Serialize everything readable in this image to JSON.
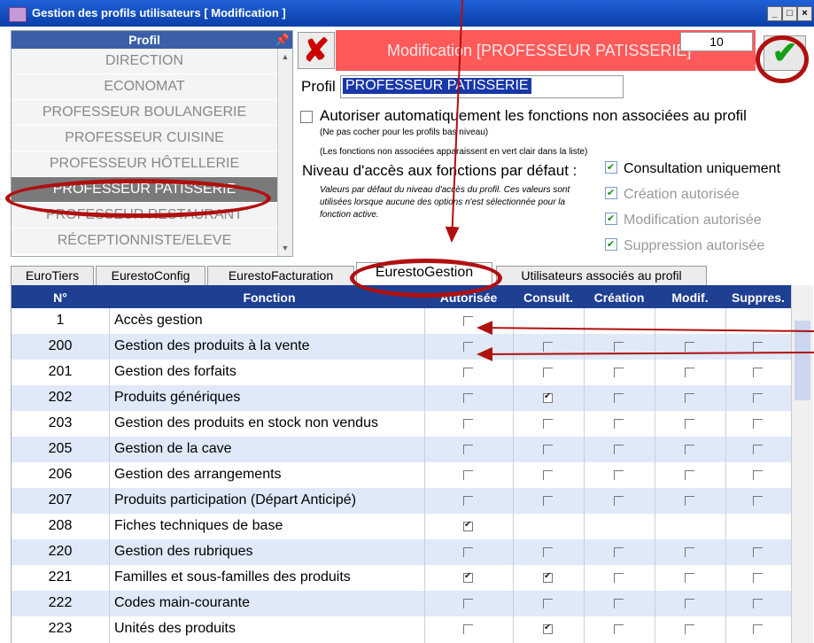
{
  "window": {
    "title": "Gestion des profils utilisateurs  [ Modification ]"
  },
  "profile_list": {
    "header": "Profil",
    "items": [
      "DIRECTION",
      "ECONOMAT",
      "PROFESSEUR BOULANGERIE",
      "PROFESSEUR CUISINE",
      "PROFESSEUR HÔTELLERIE",
      "PROFESSEUR PATISSERIE",
      "PROFESSEUR RESTAURANT",
      "RÉCEPTIONNISTE/ELEVE"
    ],
    "selected": "PROFESSEUR PATISSERIE"
  },
  "header": {
    "title": "Modification [PROFESSEUR PATISSERIE]",
    "counter": "10"
  },
  "form": {
    "profil_label": "Profil",
    "profil_value": "PROFESSEUR PATISSERIE",
    "auto_label": "Autoriser automatiquement les fonctions non associées au profil",
    "note1": "(Ne pas cocher pour les profils bas niveau)",
    "note2": "(Les fonctions non associées apparaissent en vert clair dans la liste)",
    "niveau_label": "Niveau d'accès aux fonctions par défaut :",
    "defaults_note": "Valeurs par défaut du niveau d'accès du profil. Ces valeurs sont utilisées lorsque aucune des options n'est sélectionnée pour la fonction active.",
    "options": [
      {
        "label": "Consultation uniquement",
        "checked": true,
        "enabled": true
      },
      {
        "label": "Création autorisée",
        "checked": true,
        "enabled": false
      },
      {
        "label": "Modification autorisée",
        "checked": true,
        "enabled": false
      },
      {
        "label": "Suppression autorisée",
        "checked": true,
        "enabled": false
      }
    ]
  },
  "tabs": [
    "EuroTiers",
    "EurestoConfig",
    "EurestoFacturation",
    "EurestoGestion",
    "Utilisateurs associés au profil"
  ],
  "active_tab": "EurestoGestion",
  "grid": {
    "columns": [
      "N°",
      "Fonction",
      "Autorisée",
      "Consult.",
      "Création",
      "Modif.",
      "Suppres."
    ],
    "rows": [
      {
        "n": "1",
        "fonction": "Accès gestion",
        "checks": [
          0,
          null,
          null,
          null,
          null
        ]
      },
      {
        "n": "200",
        "fonction": "Gestion des produits à la vente",
        "checks": [
          0,
          0,
          0,
          0,
          0
        ]
      },
      {
        "n": "201",
        "fonction": "Gestion des forfaits",
        "checks": [
          0,
          0,
          0,
          0,
          0
        ]
      },
      {
        "n": "202",
        "fonction": "Produits génériques",
        "checks": [
          0,
          1,
          0,
          0,
          0
        ]
      },
      {
        "n": "203",
        "fonction": "Gestion des produits en stock non vendus",
        "checks": [
          0,
          0,
          0,
          0,
          0
        ]
      },
      {
        "n": "205",
        "fonction": "Gestion de la cave",
        "checks": [
          0,
          0,
          0,
          0,
          0
        ]
      },
      {
        "n": "206",
        "fonction": "Gestion des arrangements",
        "checks": [
          0,
          0,
          0,
          0,
          0
        ]
      },
      {
        "n": "207",
        "fonction": "Produits participation (Départ Anticipé)",
        "checks": [
          0,
          0,
          0,
          0,
          0
        ]
      },
      {
        "n": "208",
        "fonction": "Fiches techniques de base",
        "checks": [
          1,
          null,
          null,
          null,
          null
        ]
      },
      {
        "n": "220",
        "fonction": "Gestion des rubriques",
        "checks": [
          0,
          0,
          0,
          0,
          0
        ]
      },
      {
        "n": "221",
        "fonction": "Familles et sous-familles des produits",
        "checks": [
          1,
          1,
          0,
          0,
          0
        ]
      },
      {
        "n": "222",
        "fonction": "Codes main-courante",
        "checks": [
          0,
          0,
          0,
          0,
          0
        ]
      },
      {
        "n": "223",
        "fonction": "Unités des produits",
        "checks": [
          0,
          1,
          0,
          0,
          0
        ]
      }
    ]
  }
}
